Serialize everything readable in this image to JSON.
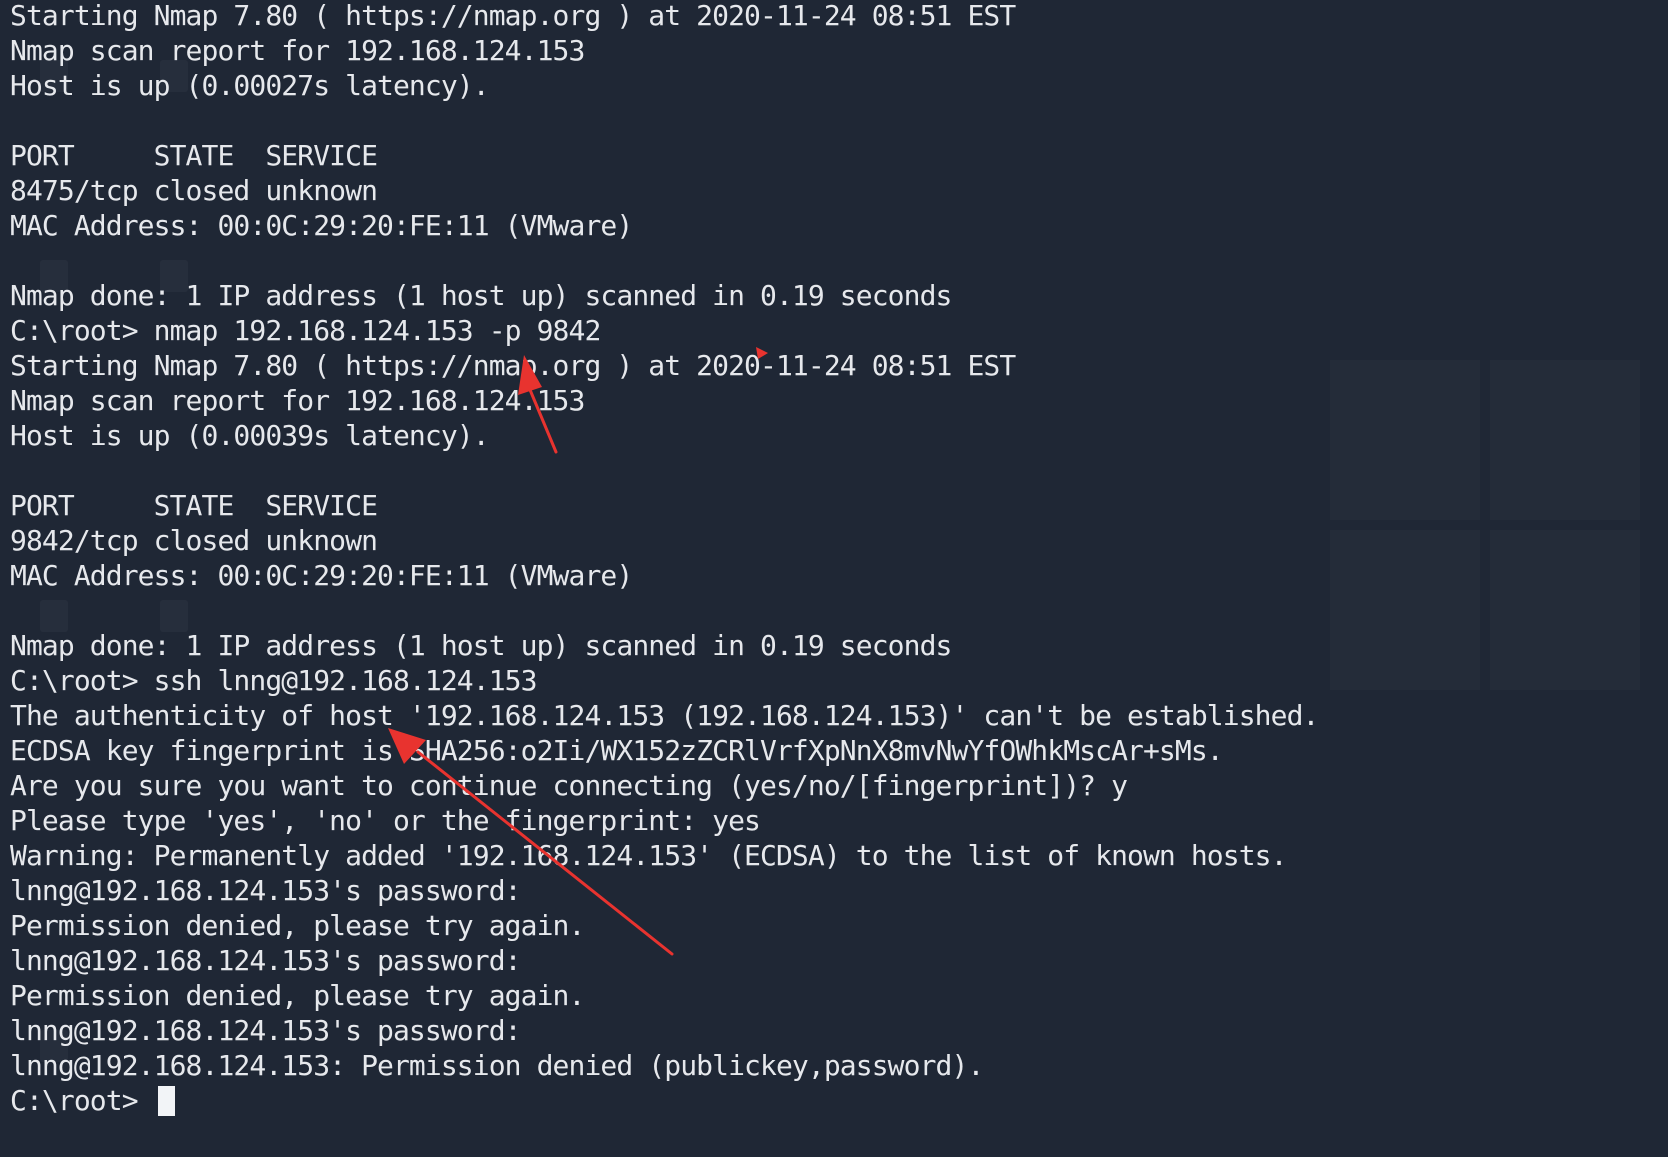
{
  "terminal": {
    "lines": [
      "Starting Nmap 7.80 ( https://nmap.org ) at 2020-11-24 08:51 EST",
      "Nmap scan report for 192.168.124.153",
      "Host is up (0.00027s latency).",
      "",
      "PORT     STATE  SERVICE",
      "8475/tcp closed unknown",
      "MAC Address: 00:0C:29:20:FE:11 (VMware)",
      "",
      "Nmap done: 1 IP address (1 host up) scanned in 0.19 seconds",
      "C:\\root> nmap 192.168.124.153 -p 9842",
      "Starting Nmap 7.80 ( https://nmap.org ) at 2020-11-24 08:51 EST",
      "Nmap scan report for 192.168.124.153",
      "Host is up (0.00039s latency).",
      "",
      "PORT     STATE  SERVICE",
      "9842/tcp closed unknown",
      "MAC Address: 00:0C:29:20:FE:11 (VMware)",
      "",
      "Nmap done: 1 IP address (1 host up) scanned in 0.19 seconds",
      "C:\\root> ssh lnng@192.168.124.153",
      "The authenticity of host '192.168.124.153 (192.168.124.153)' can't be established.",
      "ECDSA key fingerprint is SHA256:o2Ii/WX152zZCRlVrfXpNnX8mvNwYfOWhkMscAr+sMs.",
      "Are you sure you want to continue connecting (yes/no/[fingerprint])? y",
      "Please type 'yes', 'no' or the fingerprint: yes",
      "Warning: Permanently added '192.168.124.153' (ECDSA) to the list of known hosts.",
      "lnng@192.168.124.153's password: ",
      "Permission denied, please try again.",
      "lnng@192.168.124.153's password: ",
      "Permission denied, please try again.",
      "lnng@192.168.124.153's password: ",
      "lnng@192.168.124.153: Permission denied (publickey,password)."
    ],
    "prompt": "C:\\root> "
  },
  "colors": {
    "background": "#1f2735",
    "text": "#e6e8ec",
    "annotation_arrow": "#e8332f"
  },
  "icons": [
    "cursor-block",
    "annotation-arrow"
  ]
}
